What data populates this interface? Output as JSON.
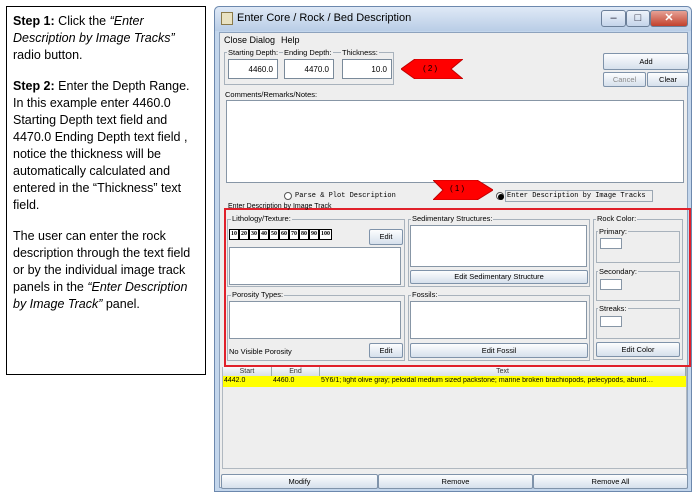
{
  "instructions": {
    "step1_label": "Step 1:",
    "step1_pre": " Click the ",
    "step1_italic": "“Enter Description by Image Tracks”",
    "step1_post": " radio button.",
    "step2_label": "Step 2:",
    "step2_text": " Enter the Depth Range.  In this example enter 4460.0  Starting Depth text field and 4470.0  Ending Depth text field , notice the thickness will be automatically calculated and entered in the “Thickness” text field.",
    "note_pre": "The user can enter the rock description through the text field or by the individual image track panels in the ",
    "note_italic": "“Enter Description by Image Track”",
    "note_post": " panel."
  },
  "window": {
    "title": "Enter Core / Rock / Bed Description",
    "minimize_glyph": "–",
    "maximize_glyph": "□",
    "close_glyph": "✕"
  },
  "menu": {
    "close_dialog": "Close Dialog",
    "help": "Help"
  },
  "depth": {
    "start_label": "Starting Depth:",
    "start_value": "4460.0",
    "end_label": "Ending Depth:",
    "end_value": "4470.0",
    "thickness_label": "Thickness:",
    "thickness_value": "10.0"
  },
  "buttons": {
    "add": "Add",
    "cancel": "Cancel",
    "clear": "Clear"
  },
  "comments_label": "Comments/Remarks/Notes:",
  "callouts": {
    "two": "( 2 )",
    "one": "( 1 )"
  },
  "mode": {
    "parse_label": "Parse & Plot Description",
    "image_label": "Enter Description by Image Tracks",
    "selected": "image"
  },
  "image_panel": {
    "title": "Enter Description by Image Track",
    "lithology": {
      "label": "Lithology/Texture:",
      "ticks": [
        "10",
        "20",
        "30",
        "40",
        "50",
        "60",
        "70",
        "80",
        "90",
        "100"
      ],
      "edit": "Edit"
    },
    "sedimentary": {
      "label": "Sedimentary Structures:",
      "edit": "Edit Sedimentary Structure"
    },
    "rock_color": {
      "label": "Rock Color:",
      "primary": "Primary:",
      "secondary": "Secondary:",
      "streaks": "Streaks:",
      "edit": "Edit Color"
    },
    "porosity": {
      "label": "Porosity Types:",
      "value": "No Visible Porosity",
      "edit": "Edit"
    },
    "fossils": {
      "label": "Fossils:",
      "edit": "Edit Fossil"
    }
  },
  "table": {
    "columns": [
      "Start",
      "End",
      "Text"
    ],
    "rows": [
      [
        "4442.0",
        "4460.0",
        "5Y6/1; light olive gray; peloidal medium sized packstone; marine broken brachiopods, pelecypods, abund…"
      ]
    ]
  },
  "bottom_buttons": {
    "modify": "Modify",
    "remove": "Remove",
    "remove_all": "Remove All"
  },
  "colors": {
    "highlight_border": "#e0202a",
    "callout_fill": "#ff0000",
    "selected_row": "#ffff00",
    "window_frame": "#c3d6ec"
  }
}
